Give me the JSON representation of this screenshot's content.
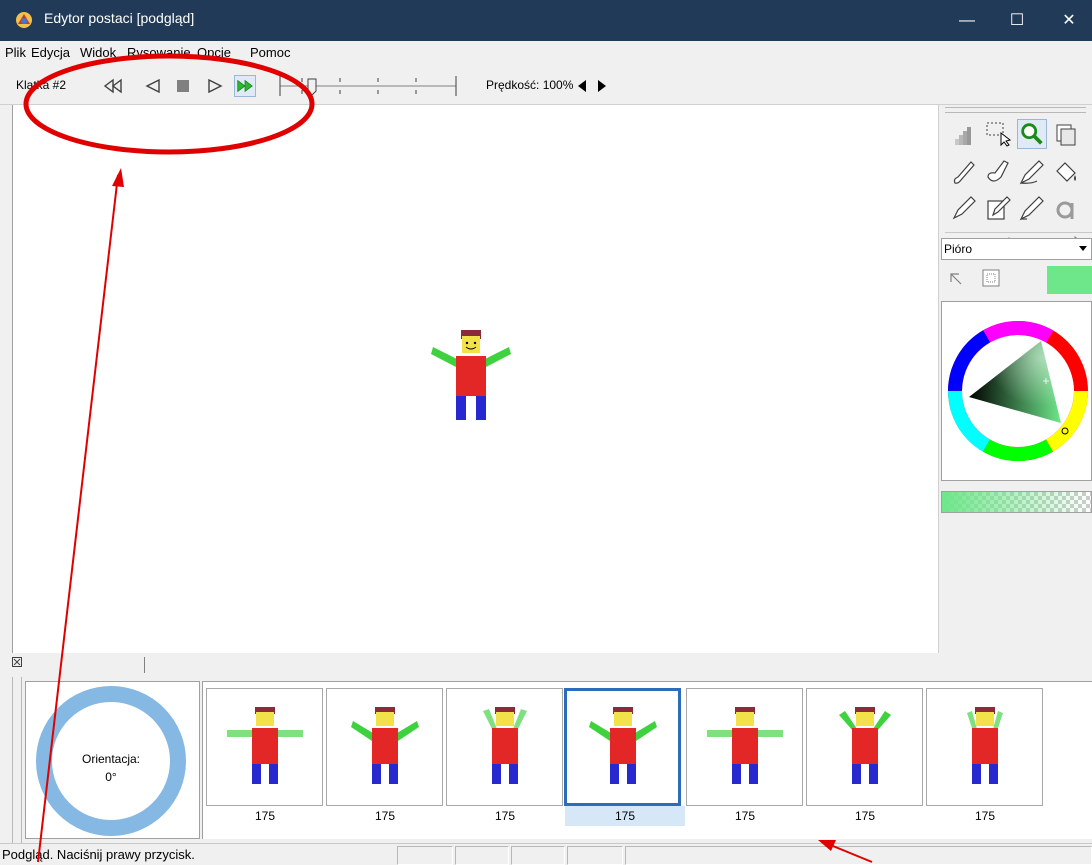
{
  "window": {
    "title": "Edytor postaci [podgląd]",
    "minimize_glyph": "—",
    "maximize_glyph": "☐",
    "close_glyph": "✕",
    "titlebar_color": "#203a57"
  },
  "menu": {
    "items": [
      "Plik",
      "Edycja",
      "Widok",
      "Rysowanie",
      "Opcje",
      "Pomoc"
    ]
  },
  "toolbar": {
    "frame_label": "Klatka #2",
    "buttons": [
      "rewind-icon",
      "play-backward-icon",
      "stop-icon",
      "play-icon",
      "fast-forward-icon"
    ],
    "speed_label": "Prędkość: 100%"
  },
  "right_panel": {
    "tools": [
      "histogram-icon",
      "select-rect-icon",
      "zoom-icon",
      "copy-frame-icon",
      "pencil-icon",
      "brush-icon",
      "pen-icon",
      "fill-icon",
      "eraser-icon",
      "edit-icon",
      "marker-icon",
      "text-icon"
    ],
    "brush_sizes": [
      "size-small",
      "size-medium",
      "size-large",
      "size-xlarge",
      "gear",
      "pointer"
    ],
    "brush_type": "Pióro",
    "current_color": "#6ee68a"
  },
  "orientation": {
    "label": "Orientacja:",
    "value": "0°"
  },
  "frames": [
    {
      "label": "175",
      "pose": "arms-horizontal-light"
    },
    {
      "label": "175",
      "pose": "arms-raised"
    },
    {
      "label": "175",
      "pose": "arms-up-light"
    },
    {
      "label": "175",
      "pose": "arms-raised",
      "selected": true
    },
    {
      "label": "175",
      "pose": "arms-horizontal-light"
    },
    {
      "label": "175",
      "pose": "arms-raised"
    },
    {
      "label": "175",
      "pose": "arms-up-light"
    }
  ],
  "status": {
    "text": "Podgląd. Naciśnij prawy przycisk."
  },
  "colors": {
    "annotation": "#e00000",
    "figure_body": "#e32626",
    "figure_legs": "#2828d0",
    "figure_arms": "#3fd23f",
    "figure_skin": "#f2e24a",
    "figure_hair": "#8a2a3a",
    "selection": "#2a6db8",
    "ring": "#86b8e4"
  }
}
